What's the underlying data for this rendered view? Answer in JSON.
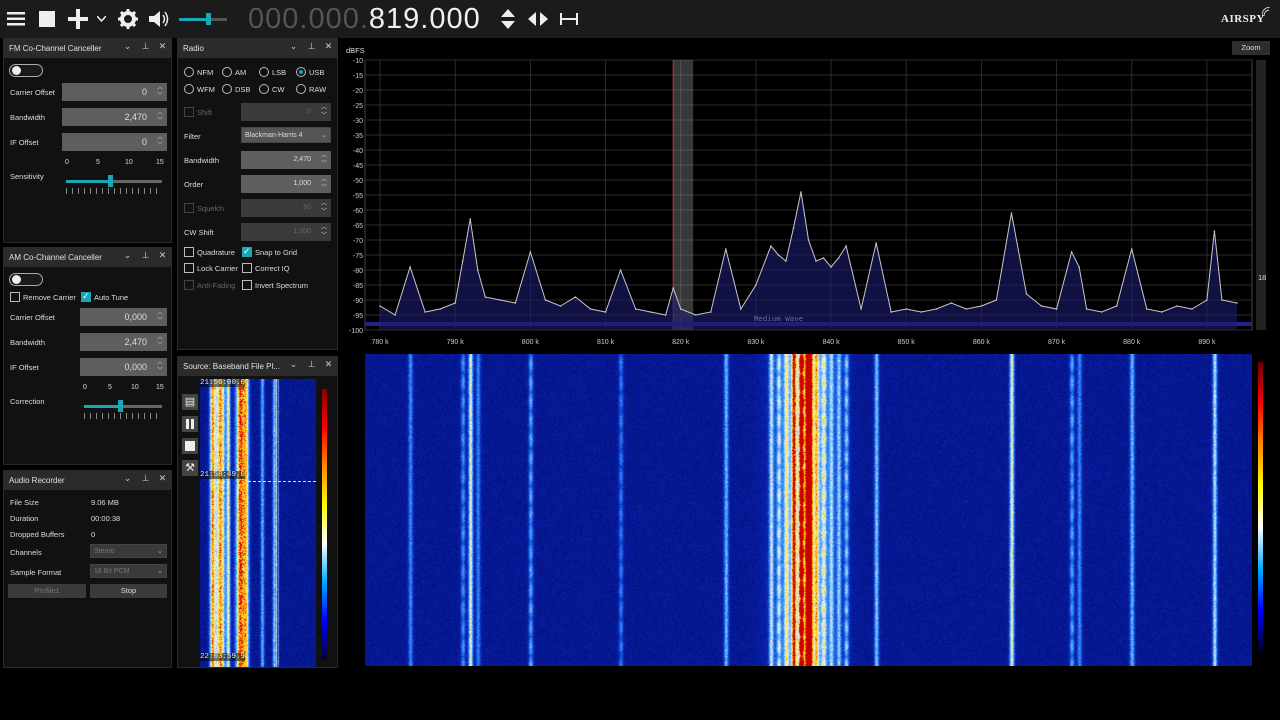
{
  "toolbar": {
    "frequency_dim": "000.000.",
    "frequency_lit": "819.000",
    "logo": "AIRSPY",
    "volume": 0.6,
    "icons": [
      "menu-icon",
      "stop-icon",
      "add-icon",
      "chevron-down-icon",
      "gear-icon",
      "speaker-icon",
      "updown-arrows-icon",
      "leftright-arrows-icon",
      "span-icon"
    ]
  },
  "fm_canceller": {
    "title": "FM Co-Channel Canceller",
    "carrier_offset_label": "Carrier Offset",
    "carrier_offset": "0",
    "bandwidth_label": "Bandwidth",
    "bandwidth": "2,470",
    "if_offset_label": "IF Offset",
    "if_offset": "0",
    "sensitivity_label": "Sensitivity",
    "scale": [
      "0",
      "5",
      "10",
      "15"
    ],
    "sensitivity_value": 0.46
  },
  "am_canceller": {
    "title": "AM Co-Channel Canceller",
    "remove_carrier": "Remove Carrier",
    "auto_tune": "Auto Tune",
    "carrier_offset_label": "Carrier Offset",
    "carrier_offset": "0,000",
    "bandwidth_label": "Bandwidth",
    "bandwidth": "2,470",
    "if_offset_label": "IF Offset",
    "if_offset": "0,000",
    "correction_label": "Correction",
    "scale": [
      "0",
      "5",
      "10",
      "15"
    ],
    "correction_value": 0.46
  },
  "audio_recorder": {
    "title": "Audio Recorder",
    "file_size_label": "File Size",
    "file_size": "9.06 MB",
    "duration_label": "Duration",
    "duration": "00:00:38",
    "dropped_label": "Dropped Buffers",
    "dropped": "0",
    "channels_label": "Channels",
    "channels": "Stereo",
    "format_label": "Sample Format",
    "format": "16 Bit PCM",
    "profile_button": "Profile1",
    "stop_button": "Stop"
  },
  "radio": {
    "title": "Radio",
    "modes": [
      "NFM",
      "AM",
      "LSB",
      "USB",
      "WFM",
      "DSB",
      "CW",
      "RAW"
    ],
    "selected_mode": "USB",
    "shift_label": "Shift",
    "shift": "0",
    "filter_label": "Filter",
    "filter": "Blackman-Harris 4",
    "bandwidth_label": "Bandwidth",
    "bandwidth": "2,470",
    "order_label": "Order",
    "order": "1,000",
    "squelch_label": "Squelch",
    "squelch": "50",
    "cw_shift_label": "CW Shift",
    "cw_shift": "1,000",
    "quadrature": "Quadrature",
    "snap_to_grid": "Snap to Grid",
    "lock_carrier": "Lock Carrier",
    "correct_iq": "Correct IQ",
    "anti_fading": "Anti-Fading",
    "invert_spectrum": "Invert Spectrum"
  },
  "source": {
    "title": "Source: Baseband File Pl...",
    "time_start": "21:56:00.0",
    "time_mid": "21:58:49.0",
    "time_end": "22:03:59.9"
  },
  "spectrum": {
    "y_unit": "dBFS",
    "zoom_label": "Zoom",
    "y_ticks": [
      "-10",
      "-15",
      "-20",
      "-25",
      "-30",
      "-35",
      "-40",
      "-45",
      "-50",
      "-55",
      "-60",
      "-65",
      "-70",
      "-75",
      "-80",
      "-85",
      "-90",
      "-95",
      "-100"
    ],
    "x_ticks": [
      "780 k",
      "790 k",
      "800 k",
      "810 k",
      "820 k",
      "830 k",
      "840 k",
      "850 k",
      "860 k",
      "870 k",
      "880 k",
      "890 k"
    ],
    "band_label": "Medium Wave",
    "side_value": "18",
    "tuned_khz": 819,
    "line_color": "#c8c8c8",
    "fill_color": "#1a1a6e"
  },
  "chart_data": {
    "type": "line",
    "x": [
      780,
      782,
      784,
      786,
      788,
      790,
      791,
      792,
      793,
      794,
      796,
      798,
      800,
      802,
      804,
      806,
      808,
      810,
      812,
      814,
      816,
      818,
      819,
      820,
      822,
      824,
      826,
      828,
      830,
      832,
      833,
      834,
      835,
      836,
      837,
      838,
      839,
      840,
      841,
      842,
      844,
      846,
      848,
      850,
      852,
      854,
      856,
      858,
      860,
      862,
      864,
      866,
      868,
      870,
      872,
      873,
      874,
      876,
      878,
      880,
      882,
      884,
      886,
      888,
      890,
      891,
      892,
      894
    ],
    "y": [
      -92,
      -95,
      -79,
      -94,
      -93,
      -91,
      -77,
      -63,
      -80,
      -89,
      -90,
      -91,
      -74,
      -90,
      -92,
      -89,
      -93,
      -94,
      -80,
      -93,
      -94,
      -95,
      -86,
      -93,
      -95,
      -94,
      -73,
      -93,
      -85,
      -72,
      -75,
      -77,
      -66,
      -54,
      -70,
      -77,
      -76,
      -79,
      -76,
      -72,
      -93,
      -71,
      -94,
      -93,
      -94,
      -93,
      -91,
      -93,
      -92,
      -90,
      -61,
      -88,
      -92,
      -93,
      -74,
      -79,
      -93,
      -94,
      -92,
      -73,
      -93,
      -94,
      -92,
      -93,
      -90,
      -67,
      -90,
      -91
    ],
    "xlabel": "",
    "ylabel": "dBFS",
    "xlim": [
      778,
      896
    ],
    "ylim": [
      -100,
      -10
    ]
  }
}
